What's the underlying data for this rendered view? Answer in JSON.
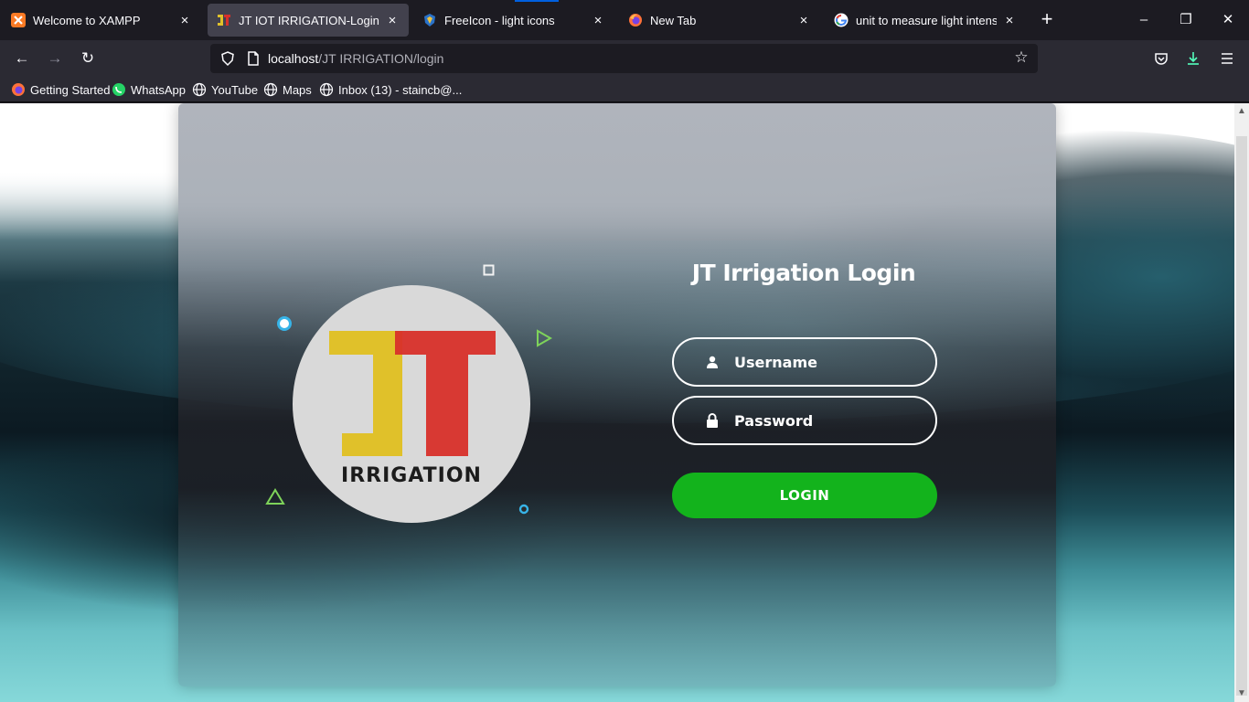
{
  "browser": {
    "tabs": [
      {
        "title": "Welcome to XAMPP",
        "icon": "xampp-icon"
      },
      {
        "title": "JT IOT IRRIGATION-Login",
        "icon": "jt-logo-icon",
        "active": true
      },
      {
        "title": "FreeIcon - light icons",
        "icon": "freeicon-icon"
      },
      {
        "title": "New Tab",
        "icon": "firefox-icon"
      },
      {
        "title": "unit to measure light intensity -",
        "icon": "google-icon"
      }
    ],
    "new_tab_symbol": "+",
    "close_symbol": "×",
    "window_controls": {
      "minimize": "–",
      "restore": "❐",
      "close": "✕"
    },
    "nav": {
      "back": "←",
      "forward": "→",
      "reload": "↻"
    },
    "url": {
      "host": "localhost",
      "path": "/JT IRRIGATION/login"
    },
    "star": "☆",
    "bookmarks": [
      {
        "label": "Getting Started",
        "icon": "firefox-icon"
      },
      {
        "label": "WhatsApp",
        "icon": "whatsapp-icon"
      },
      {
        "label": "YouTube",
        "icon": "globe-icon"
      },
      {
        "label": "Maps",
        "icon": "globe-icon"
      },
      {
        "label": "Inbox (13) - staincb@...",
        "icon": "globe-icon"
      }
    ]
  },
  "page": {
    "logo": {
      "letters": "JT",
      "text": "IRRIGATION",
      "colors": {
        "j": "#e0c12a",
        "t": "#d8302a"
      }
    },
    "title": "JT Irrigation Login",
    "username": {
      "placeholder": "Username",
      "icon": "user-icon"
    },
    "password": {
      "placeholder": "Password",
      "icon": "lock-icon"
    },
    "login_button": "LOGIN",
    "colors": {
      "button": "#13b31c",
      "accent_blue": "#37b4e8",
      "accent_green": "#7ed35a"
    }
  }
}
